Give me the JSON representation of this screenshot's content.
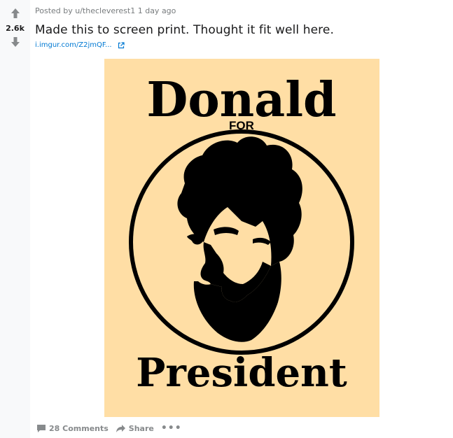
{
  "post": {
    "score": "2.6k",
    "posted_by": "Posted by u/thecleverest1 1 day ago",
    "title": "Made this to screen print. Thought it fit well here.",
    "link_text": "i.imgur.com/Z2jmQF...",
    "poster": {
      "headline": "Donald",
      "middle": "FOR",
      "footer": "President",
      "background": "#ffdea5"
    },
    "actions": {
      "comments_label": "28 Comments",
      "share_label": "Share",
      "more_label": "•••"
    }
  },
  "icons": {
    "upvote": "arrow-up-icon",
    "downvote": "arrow-down-icon",
    "external_link": "external-link-icon",
    "comments": "comment-bubble-icon",
    "share": "share-arrow-icon"
  },
  "colors": {
    "vote_column_bg": "#f8f9fa",
    "meta_text": "#787c7e",
    "link": "#0079d3",
    "action_text": "#878a8c",
    "title_text": "#1a1a1b"
  }
}
